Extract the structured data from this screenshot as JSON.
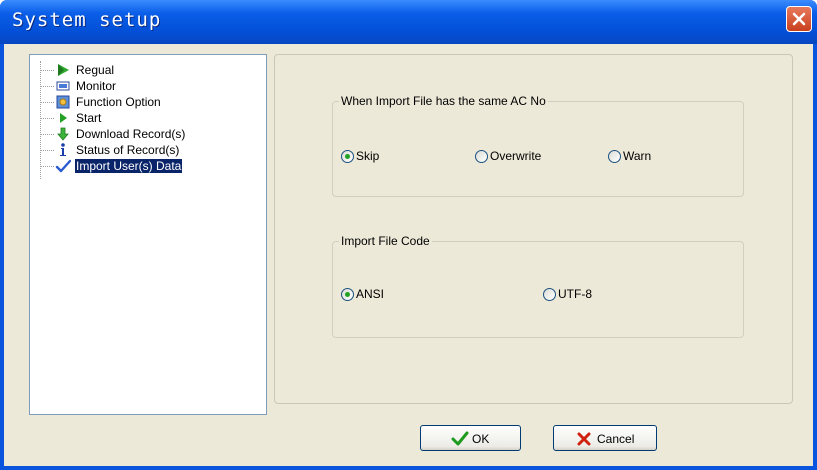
{
  "window": {
    "title": "System setup"
  },
  "tree": {
    "items": [
      {
        "label": "Regual",
        "icon": "play-arrow-green-icon",
        "selected": false
      },
      {
        "label": "Monitor",
        "icon": "monitor-icon",
        "selected": false
      },
      {
        "label": "Function Option",
        "icon": "settings-box-icon",
        "selected": false
      },
      {
        "label": "Start",
        "icon": "play-triangle-icon",
        "selected": false
      },
      {
        "label": "Download Record(s)",
        "icon": "download-arrow-icon",
        "selected": false
      },
      {
        "label": "Status of Record(s)",
        "icon": "info-icon",
        "selected": false
      },
      {
        "label": "Import User(s) Data",
        "icon": "checkmark-icon",
        "selected": true
      }
    ]
  },
  "groups": {
    "same_ac": {
      "title": "When Import File has the same AC No",
      "options": [
        {
          "label": "Skip",
          "checked": true
        },
        {
          "label": "Overwrite",
          "checked": false
        },
        {
          "label": "Warn",
          "checked": false
        }
      ]
    },
    "file_code": {
      "title": "Import File Code",
      "options": [
        {
          "label": "ANSI",
          "checked": true
        },
        {
          "label": "UTF-8",
          "checked": false
        }
      ]
    }
  },
  "buttons": {
    "ok": "OK",
    "cancel": "Cancel"
  },
  "colors": {
    "titlebar": "#0a5ee8",
    "selection": "#0a246a",
    "radio_dot": "#21a121",
    "close": "#c8401e"
  }
}
